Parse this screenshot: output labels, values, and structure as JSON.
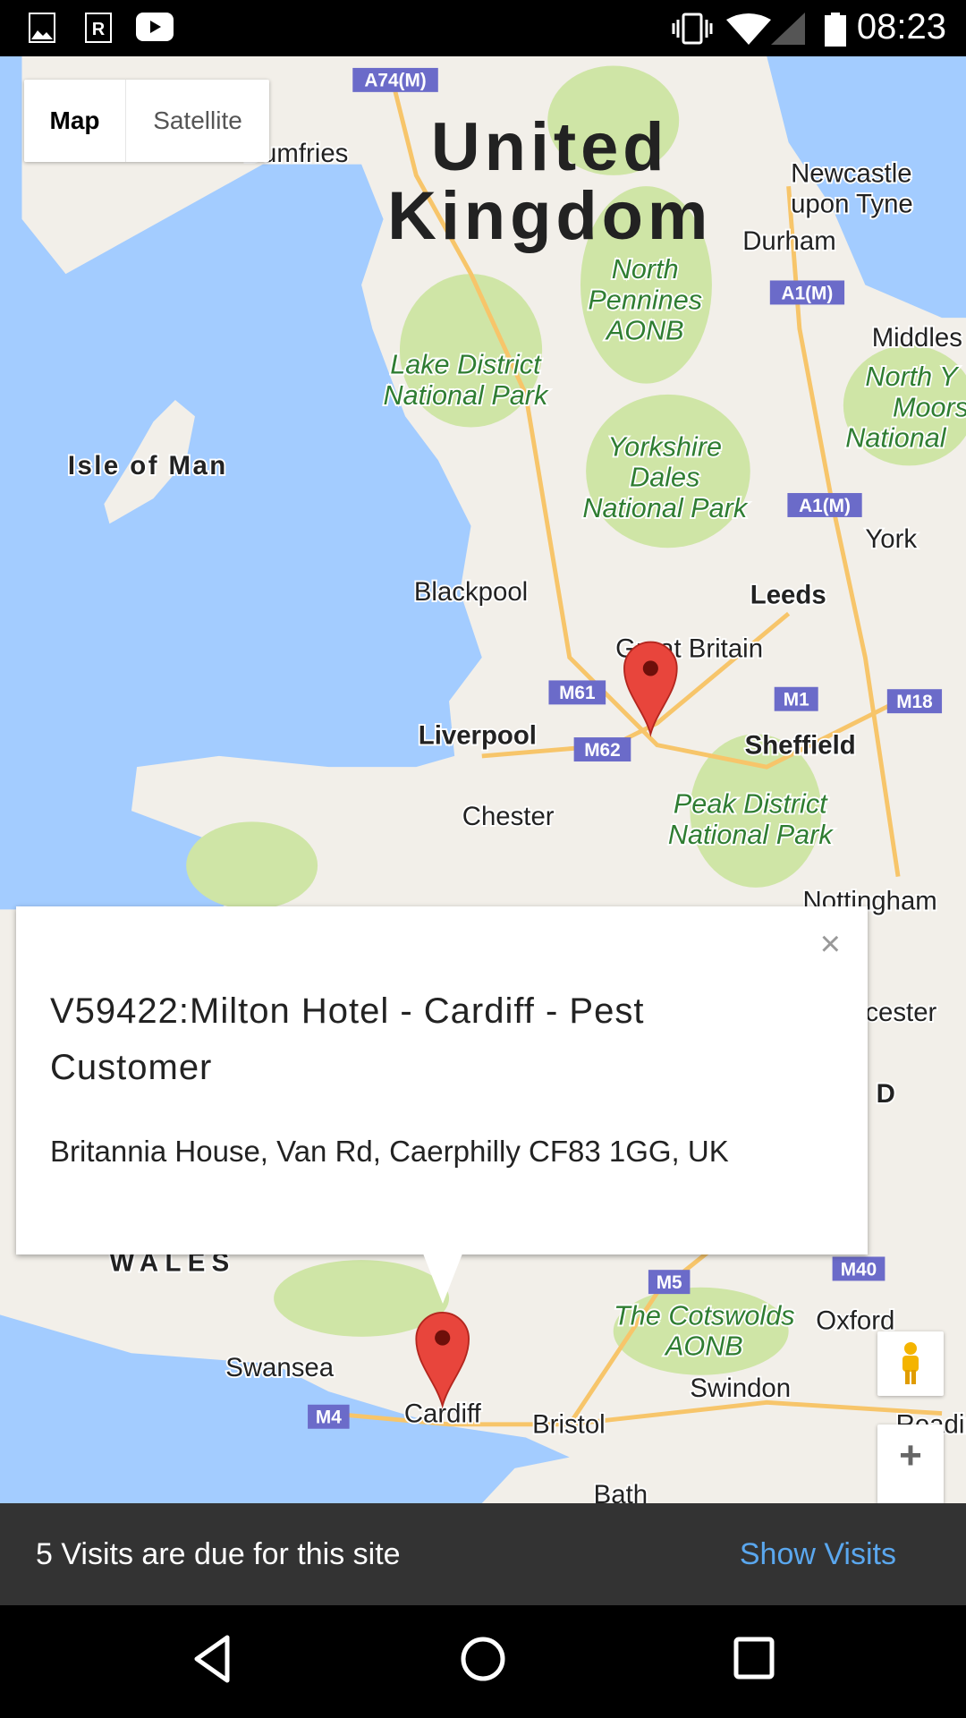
{
  "status_bar": {
    "time": "08:23",
    "icons": [
      "image-icon",
      "r-app-icon",
      "youtube-icon",
      "vibrate-icon",
      "wifi-icon",
      "signal-icon",
      "battery-icon"
    ]
  },
  "map": {
    "type_control": {
      "map": "Map",
      "satellite": "Satellite",
      "selected": "Map"
    },
    "country_label": [
      "United",
      "Kingdom"
    ],
    "places": [
      "Dumfries",
      "Newcastle",
      "upon Tyne",
      "Durham",
      "Middles",
      "Isle of Man",
      "York",
      "Blackpool",
      "Leeds",
      "Great Britain",
      "Liverpool",
      "Sheffield",
      "Chester",
      "Nottingham",
      "cester",
      "D",
      "WALES",
      "Swansea",
      "Cardiff",
      "Bristol",
      "Oxford",
      "Swindon",
      "Reading",
      "Bath"
    ],
    "parks": [
      "North",
      "Pennines",
      "AONB",
      "Lake District",
      "National Park",
      "North Y",
      "Moors",
      "National",
      "Yorkshire",
      "Dales",
      "National Park",
      "Peak District",
      "National Park",
      "The Cotswolds",
      "AONB"
    ],
    "road_shields": [
      "A74(M)",
      "A1(M)",
      "A1(M)",
      "M61",
      "M1",
      "M18",
      "M62",
      "M5",
      "M40",
      "M4"
    ],
    "colors": {
      "sea": "#a3ccff",
      "land": "#f2efe9",
      "park": "#cfe5a6",
      "road": "#f7c56a",
      "marker": "#e8453c",
      "shield": "#6b6bc9"
    }
  },
  "info_window": {
    "title": "V59422:Milton Hotel - Cardiff - Pest Customer",
    "address": "Britannia House, Van Rd, Caerphilly CF83 1GG, UK",
    "close": "×"
  },
  "controls": {
    "zoom_in": "+"
  },
  "bottom_bar": {
    "message": "5 Visits are due for this site",
    "action": "Show Visits"
  }
}
